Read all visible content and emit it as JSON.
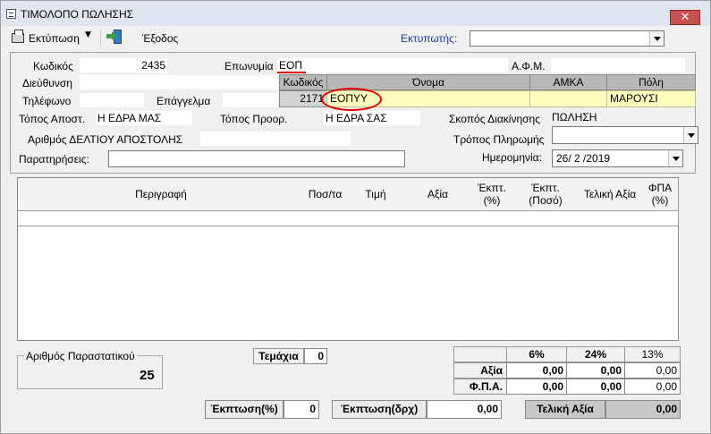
{
  "window": {
    "title": "ΤΙΜΟΛΟΠΟ ΠΩΛΗΣΗΣ",
    "close_symbol": "✕"
  },
  "toolbar": {
    "print_label": "Εκτύπωση",
    "exit_label": "Έξοδος",
    "printers_label": "Εκτυπωτής:",
    "printer_value": ""
  },
  "customer": {
    "code_label": "Κωδικός",
    "code_value": "2435",
    "name_label": "Επωνυμία",
    "name_value": "ΕΟΠ",
    "afm_label": "Α.Φ.Μ.",
    "afm_value": "",
    "address_label": "Διεύθυνση",
    "address_value": "",
    "phone_label": "Τηλέφωνο",
    "phone_value": "",
    "profession_label": "Επάγγελμα",
    "profession_value": ""
  },
  "lookup": {
    "headers": [
      "Κωδικός",
      "Όνομα",
      "ΑΜΚΑ",
      "Πόλη"
    ],
    "row": {
      "code": "2171",
      "name": "ΕΟΠΥΥ",
      "amka": "",
      "city": "ΜΑΡΟΥΣΙ"
    }
  },
  "shipping": {
    "from_label": "Τόπος Αποστ.",
    "from_value": "Η ΕΔΡΑ ΜΑΣ",
    "to_label": "Τόπος Προορ.",
    "to_value": "Η ΕΔΡΑ ΣΑΣ",
    "purpose_label": "Σκοπός Διακίνησης",
    "purpose_value": "ΠΩΛΗΣΗ",
    "delivery_label": "Αριθμός ΔΕΛΤΙΟΥ ΑΠΟΣΤΟΛΗΣ",
    "delivery_value": "",
    "payment_label": "Τρόπος Πληρωμής",
    "payment_value": "",
    "notes_label": "Παρατηρήσεις:",
    "notes_value": "",
    "date_label": "Ημερομηνία:",
    "date_value": "26/ 2 /2019"
  },
  "grid": {
    "columns": [
      "Περιγραφή",
      "Ποσ/τα",
      "Τιμή",
      "Αξία",
      "Έκπτ. (%)",
      "Έκπτ. (Ποσό)",
      "Τελική Αξία",
      "ΦΠΑ (%)"
    ]
  },
  "doc_number": {
    "label": "Αριθμός Παραστατικού",
    "value": "25"
  },
  "totals": {
    "items_label": "Τεμάχια",
    "items_value": "0",
    "vat_rates": [
      "6%",
      "24%",
      "13%"
    ],
    "value_label": "Αξία",
    "value_amounts": [
      "0,00",
      "0,00",
      "0,00"
    ],
    "vat_label": "Φ.Π.Α.",
    "vat_amounts": [
      "0,00",
      "0,00",
      "0,00"
    ],
    "discount_pct_label": "Έκπτωση(%)",
    "discount_pct_value": "0",
    "discount_amt_label": "Έκπτωση(δρχ)",
    "discount_amt_value": "0,00",
    "final_label": "Τελική Αξία",
    "final_value": "0,00"
  }
}
